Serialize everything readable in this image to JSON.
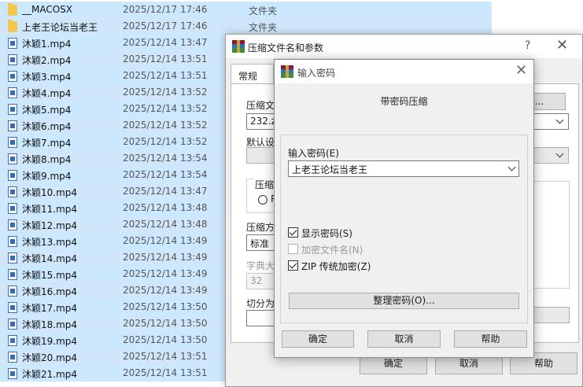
{
  "files": [
    {
      "name": "__MACOSX",
      "date": "2025/12/17 17:46",
      "type": "文件夹",
      "icon": "folder-icon"
    },
    {
      "name": "上老王论坛当老王",
      "date": "2025/12/17 17:46",
      "type": "文件夹",
      "icon": "folder-icon"
    },
    {
      "name": "沐颖1.mp4",
      "date": "2025/12/14 13:47",
      "icon": "video-file-icon"
    },
    {
      "name": "沐颖2.mp4",
      "date": "2025/12/14 13:51",
      "icon": "video-file-icon"
    },
    {
      "name": "沐颖3.mp4",
      "date": "2025/12/14 13:51",
      "icon": "video-file-icon"
    },
    {
      "name": "沐颖4.mp4",
      "date": "2025/12/14 13:52",
      "icon": "video-file-icon"
    },
    {
      "name": "沐颖5.mp4",
      "date": "2025/12/14 13:52",
      "icon": "video-file-icon"
    },
    {
      "name": "沐颖6.mp4",
      "date": "2025/12/14 13:52",
      "icon": "video-file-icon"
    },
    {
      "name": "沐颖7.mp4",
      "date": "2025/12/14 13:52",
      "icon": "video-file-icon"
    },
    {
      "name": "沐颖8.mp4",
      "date": "2025/12/14 13:54",
      "icon": "video-file-icon"
    },
    {
      "name": "沐颖9.mp4",
      "date": "2025/12/14 13:54",
      "icon": "video-file-icon"
    },
    {
      "name": "沐颖10.mp4",
      "date": "2025/12/14 13:47",
      "icon": "video-file-icon"
    },
    {
      "name": "沐颖11.mp4",
      "date": "2025/12/14 13:48",
      "icon": "video-file-icon"
    },
    {
      "name": "沐颖12.mp4",
      "date": "2025/12/14 13:48",
      "icon": "video-file-icon"
    },
    {
      "name": "沐颖13.mp4",
      "date": "2025/12/14 13:49",
      "icon": "video-file-icon"
    },
    {
      "name": "沐颖14.mp4",
      "date": "2025/12/14 13:49",
      "icon": "video-file-icon"
    },
    {
      "name": "沐颖15.mp4",
      "date": "2025/12/14 13:49",
      "icon": "video-file-icon"
    },
    {
      "name": "沐颖16.mp4",
      "date": "2025/12/14 13:49",
      "icon": "video-file-icon"
    },
    {
      "name": "沐颖17.mp4",
      "date": "2025/12/14 13:50",
      "icon": "video-file-icon"
    },
    {
      "name": "沐颖18.mp4",
      "date": "2025/12/14 13:50",
      "icon": "video-file-icon"
    },
    {
      "name": "沐颖19.mp4",
      "date": "2025/12/14 13:50",
      "icon": "video-file-icon"
    },
    {
      "name": "沐颖20.mp4",
      "date": "2025/12/14 13:51",
      "icon": "video-file-icon"
    },
    {
      "name": "沐颖21.mp4",
      "date": "2025/12/14 13:51",
      "icon": "video-file-icon"
    }
  ],
  "outer_dialog": {
    "title": "压缩文件名和参数",
    "help_glyph": "?",
    "close_glyph": "✕",
    "tab_general": "常规",
    "archive_name_label": "压缩文",
    "archive_name_value": "232.zip",
    "browse_button": "(B)...",
    "default_label": "默认设",
    "format_group_label": "压缩",
    "radio_label": "R",
    "method_label": "压缩方",
    "method_value": "标准",
    "dict_label": "字典大",
    "dict_value": "32",
    "split_label": "切分为",
    "ok_button": "确定",
    "cancel_button": "取消",
    "help_button": "帮助"
  },
  "password_dialog": {
    "title": "输入密码",
    "close_glyph": "✕",
    "heading": "带密码压缩",
    "password_label": "输入密码(E)",
    "password_value": "上老王论坛当老王",
    "show_password_label": "显示密码(S)",
    "show_password_checked": true,
    "encrypt_names_label": "加密文件名(N)",
    "encrypt_names_checked": false,
    "zip_legacy_label": "ZIP 传统加密(Z)",
    "zip_legacy_checked": true,
    "manage_button": "整理密码(O)...",
    "ok_button": "确定",
    "cancel_button": "取消",
    "help_button": "帮助"
  },
  "colors": {
    "selection": "#cce8ff",
    "dialog_bg": "#f0f0f0",
    "button_bg": "#e1e1e1"
  }
}
